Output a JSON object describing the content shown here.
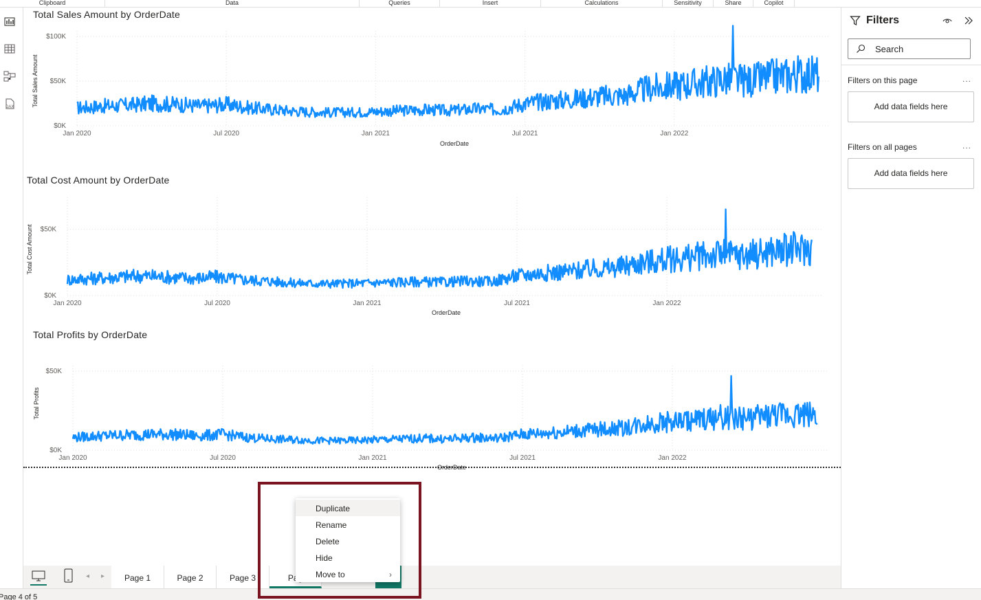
{
  "ribbon": {
    "groups": [
      "Clipboard",
      "Data",
      "Queries",
      "Insert",
      "Calculations",
      "Sensitivity",
      "Share",
      "Copilot"
    ]
  },
  "left_rail": {
    "items": [
      "report-view-icon",
      "table-view-icon",
      "model-view-icon",
      "dax-query-view-icon"
    ]
  },
  "colors": {
    "series": "#118DFF",
    "accent": "#117865",
    "highlight_box": "#7a1420"
  },
  "chart_data": [
    {
      "type": "line",
      "title": "Total Sales Amount by OrderDate",
      "xlabel": "OrderDate",
      "ylabel": "Total Sales Amount",
      "x_ticks": [
        "Jan 2020",
        "Jul 2020",
        "Jan 2021",
        "Jul 2021",
        "Jan 2022"
      ],
      "y_ticks": [
        "$0K",
        "$50K",
        "$100K"
      ],
      "ylim": [
        0,
        100000
      ],
      "x_range": [
        "2020-01-01",
        "2022-06-30"
      ],
      "grid": true,
      "series": [
        {
          "x": [
            "2020-01",
            "2020-02",
            "2020-03",
            "2020-04",
            "2020-05",
            "2020-06",
            "2020-07",
            "2020-08",
            "2020-09",
            "2020-10",
            "2020-11",
            "2020-12",
            "2021-01",
            "2021-02",
            "2021-03",
            "2021-04",
            "2021-05",
            "2021-06",
            "2021-07",
            "2021-08",
            "2021-09",
            "2021-10",
            "2021-11",
            "2021-12",
            "2022-01",
            "2022-02",
            "2022-03",
            "2022-04",
            "2022-05",
            "2022-06"
          ],
          "y": [
            20000,
            22000,
            23000,
            25000,
            24000,
            22000,
            24000,
            20000,
            18000,
            16000,
            15000,
            15000,
            16000,
            17000,
            18000,
            17000,
            19000,
            18000,
            25000,
            28000,
            30000,
            33000,
            34000,
            42000,
            45000,
            48000,
            52000,
            50000,
            55000,
            58000
          ],
          "peak": {
            "x": "2022-03",
            "y": 112000
          }
        }
      ]
    },
    {
      "type": "line",
      "title": "Total Cost Amount by OrderDate",
      "xlabel": "OrderDate",
      "ylabel": "Total Cost Amount",
      "x_ticks": [
        "Jan 2020",
        "Jul 2020",
        "Jan 2021",
        "Jul 2021",
        "Jan 2022"
      ],
      "y_ticks": [
        "$0K",
        "$50K"
      ],
      "ylim": [
        0,
        70000
      ],
      "x_range": [
        "2020-01-01",
        "2022-06-30"
      ],
      "grid": true,
      "series": [
        {
          "x": [
            "2020-01",
            "2020-02",
            "2020-03",
            "2020-04",
            "2020-05",
            "2020-06",
            "2020-07",
            "2020-08",
            "2020-09",
            "2020-10",
            "2020-11",
            "2020-12",
            "2021-01",
            "2021-02",
            "2021-03",
            "2021-04",
            "2021-05",
            "2021-06",
            "2021-07",
            "2021-08",
            "2021-09",
            "2021-10",
            "2021-11",
            "2021-12",
            "2022-01",
            "2022-02",
            "2022-03",
            "2022-04",
            "2022-05",
            "2022-06"
          ],
          "y": [
            12000,
            13000,
            14000,
            15000,
            14000,
            13000,
            14000,
            12000,
            11000,
            9500,
            9000,
            9000,
            9500,
            10000,
            10500,
            10000,
            11000,
            10500,
            15000,
            17000,
            18000,
            20000,
            21000,
            25000,
            27000,
            29000,
            31000,
            30000,
            33000,
            35000
          ],
          "peak": {
            "x": "2022-03",
            "y": 65000
          }
        }
      ]
    },
    {
      "type": "line",
      "title": "Total Profits by OrderDate",
      "xlabel": "OrderDate",
      "ylabel": "Total Profits",
      "x_ticks": [
        "Jan 2020",
        "Jul 2020",
        "Jan 2021",
        "Jul 2021",
        "Jan 2022"
      ],
      "y_ticks": [
        "$0K",
        "$50K"
      ],
      "ylim": [
        0,
        50000
      ],
      "x_range": [
        "2020-01-01",
        "2022-06-30"
      ],
      "grid": true,
      "series": [
        {
          "x": [
            "2020-01",
            "2020-02",
            "2020-03",
            "2020-04",
            "2020-05",
            "2020-06",
            "2020-07",
            "2020-08",
            "2020-09",
            "2020-10",
            "2020-11",
            "2020-12",
            "2021-01",
            "2021-02",
            "2021-03",
            "2021-04",
            "2021-05",
            "2021-06",
            "2021-07",
            "2021-08",
            "2021-09",
            "2021-10",
            "2021-11",
            "2021-12",
            "2022-01",
            "2022-02",
            "2022-03",
            "2022-04",
            "2022-05",
            "2022-06"
          ],
          "y": [
            8000,
            9000,
            9500,
            10000,
            10000,
            9000,
            10000,
            8000,
            7000,
            6500,
            6000,
            6000,
            6500,
            7000,
            7500,
            7000,
            8000,
            7500,
            10000,
            11000,
            12000,
            13000,
            14000,
            17000,
            18000,
            19000,
            21000,
            20000,
            22000,
            23000
          ],
          "peak": {
            "x": "2022-03",
            "y": 47000
          }
        }
      ]
    }
  ],
  "filters": {
    "title": "Filters",
    "search_placeholder": "Search",
    "this_page_label": "Filters on this page",
    "all_pages_label": "Filters on all pages",
    "more": "...",
    "add_fields_1": "Add data fields here",
    "add_fields_2": "Add data fields here"
  },
  "tabs": {
    "pages": [
      "Page 1",
      "Page 2",
      "Page 3",
      "Pag"
    ],
    "active_index": 3
  },
  "status": {
    "page_indicator": "Page 4 of 5"
  },
  "context_menu": {
    "items": [
      "Duplicate",
      "Rename",
      "Delete",
      "Hide",
      "Move to"
    ],
    "hovered_index": 0
  }
}
